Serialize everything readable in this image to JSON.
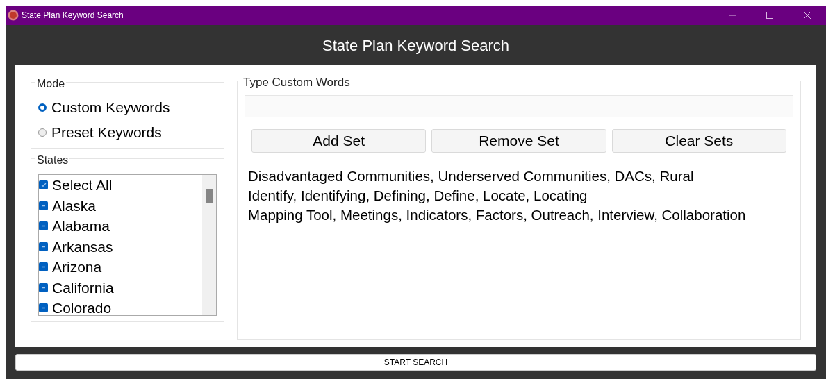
{
  "window": {
    "title": "State Plan Keyword Search"
  },
  "heading": "State Plan Keyword Search",
  "mode": {
    "label": "Mode",
    "options": [
      {
        "label": "Custom Keywords",
        "selected": true
      },
      {
        "label": "Preset Keywords",
        "selected": false
      }
    ]
  },
  "states": {
    "label": "States",
    "items": [
      {
        "kind": "all",
        "label": "Select All",
        "checked": true
      },
      {
        "kind": "state",
        "label": "Alaska",
        "checked": true
      },
      {
        "kind": "state",
        "label": "Alabama",
        "checked": true
      },
      {
        "kind": "state",
        "label": "Arkansas",
        "checked": true
      },
      {
        "kind": "state",
        "label": "Arizona",
        "checked": true
      },
      {
        "kind": "state",
        "label": "California",
        "checked": true
      },
      {
        "kind": "state",
        "label": "Colorado",
        "checked": true
      }
    ]
  },
  "custom": {
    "label": "Type Custom Words",
    "buttons": [
      "Add Set",
      "Remove Set",
      "Clear Sets"
    ],
    "sets": [
      "Disadvantaged Communities, Underserved Communities, DACs, Rural",
      "Identify, Identifying, Defining, Define, Locate, Locating",
      "Mapping Tool, Meetings, Indicators, Factors, Outreach, Interview, Collaboration"
    ]
  },
  "start_button": "START SEARCH"
}
